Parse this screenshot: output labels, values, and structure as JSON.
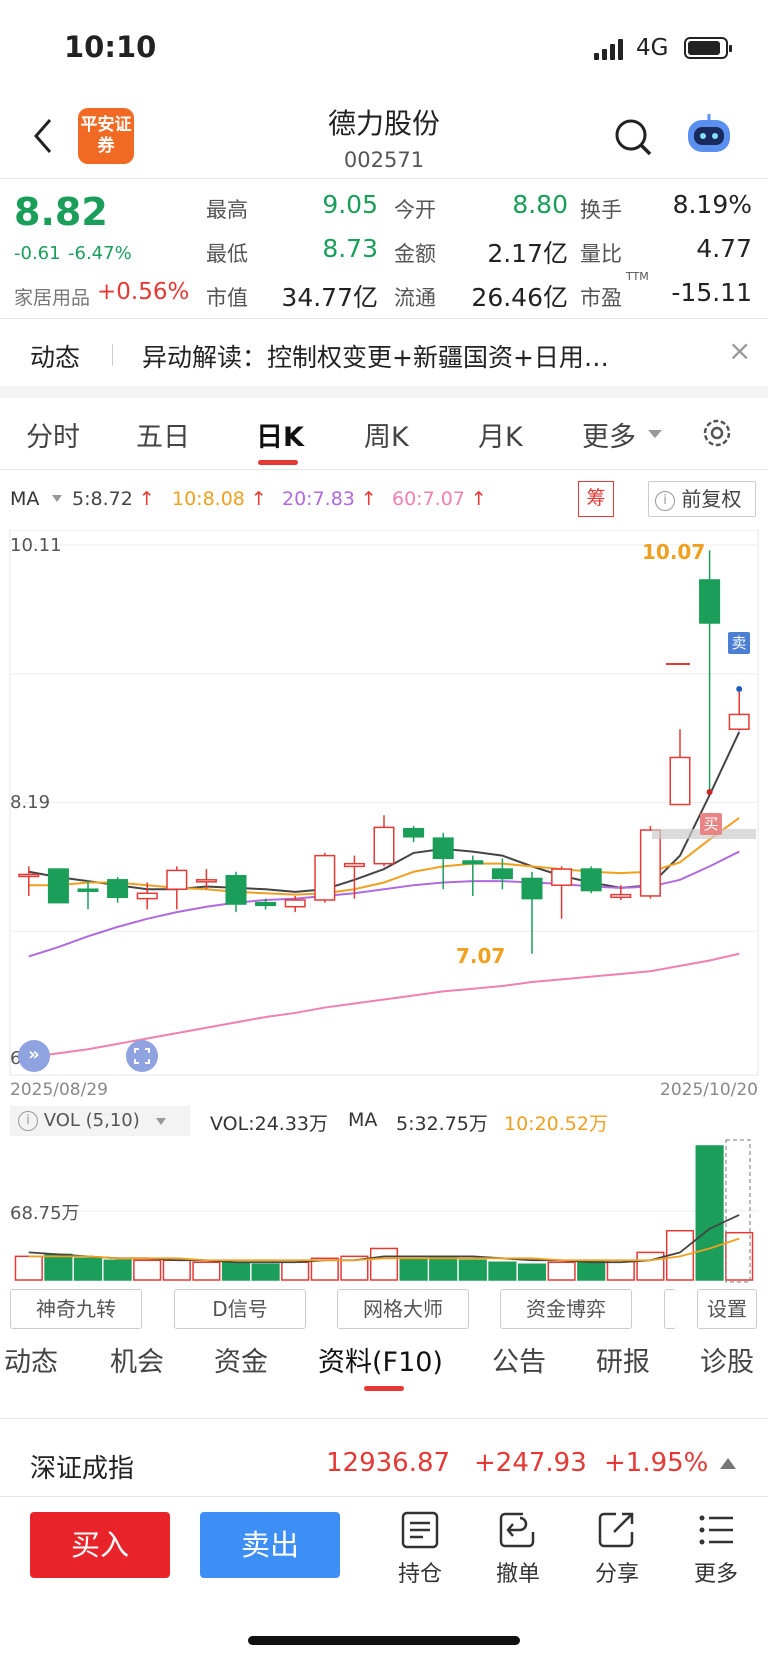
{
  "status": {
    "time": "10:10",
    "network": "4G",
    "battery_level": 0.9
  },
  "header": {
    "logo_text": "平安证券",
    "title": "德力股份",
    "code": "002571"
  },
  "quote": {
    "price": "8.82",
    "change": "-0.61",
    "change_pct": "-6.47%",
    "sector_name": "家居用品",
    "sector_change": "+0.56%",
    "fields": [
      {
        "label": "最高",
        "value": "9.05"
      },
      {
        "label": "今开",
        "value": "8.80"
      },
      {
        "label": "换手",
        "value": "8.19%"
      },
      {
        "label": "最低",
        "value": "8.73"
      },
      {
        "label": "金额",
        "value": "2.17亿"
      },
      {
        "label": "量比",
        "value": "4.77"
      },
      {
        "label": "市值",
        "value": "34.77亿"
      },
      {
        "label": "流通",
        "value": "26.46亿"
      },
      {
        "label": "市盈",
        "value": "-15.11"
      }
    ],
    "pe_superscript": "TTM"
  },
  "news": {
    "label": "动态",
    "text": "异动解读：控制权变更+新疆国资+日用…",
    "close": "×"
  },
  "kline_tabs": [
    "分时",
    "五日",
    "日K",
    "周K",
    "月K",
    "更多"
  ],
  "kline_active": 2,
  "ma_bar": {
    "label": "MA",
    "items": [
      {
        "text": "5:8.72",
        "color": "#444"
      },
      {
        "text": "10:8.08",
        "color": "#f0a020"
      },
      {
        "text": "20:7.83",
        "color": "#b06ae0"
      },
      {
        "text": "60:7.07",
        "color": "#f080b0"
      }
    ],
    "chip_label": "筹",
    "adjust_label": "前复权"
  },
  "chart": {
    "y_top": "10.11",
    "y_mid": "8.19",
    "y_bottom": "6.28",
    "high_label": "10.07",
    "low_label": "7.07",
    "sell_mark": "卖",
    "buy_mark": "买",
    "date_start": "2025/08/29",
    "date_end": "2025/10/20"
  },
  "chart_data": {
    "type": "candlestick",
    "x_start": "2025/08/29",
    "x_end": "2025/10/20",
    "ylim": [
      6.28,
      10.11
    ],
    "candles": [
      [
        7.65,
        7.66,
        7.72,
        7.5
      ],
      [
        7.7,
        7.45,
        7.7,
        7.45
      ],
      [
        7.55,
        7.54,
        7.62,
        7.4
      ],
      [
        7.62,
        7.49,
        7.64,
        7.45
      ],
      [
        7.48,
        7.52,
        7.6,
        7.4
      ],
      [
        7.55,
        7.69,
        7.72,
        7.4
      ],
      [
        7.61,
        7.62,
        7.7,
        7.55
      ],
      [
        7.65,
        7.44,
        7.68,
        7.38
      ],
      [
        7.45,
        7.43,
        7.48,
        7.4
      ],
      [
        7.42,
        7.47,
        7.5,
        7.38
      ],
      [
        7.47,
        7.8,
        7.82,
        7.45
      ],
      [
        7.72,
        7.74,
        7.8,
        7.48
      ],
      [
        7.74,
        8.01,
        8.1,
        7.72
      ],
      [
        8.0,
        7.94,
        8.02,
        7.9
      ],
      [
        7.93,
        7.78,
        7.97,
        7.55
      ],
      [
        7.76,
        7.74,
        7.8,
        7.5
      ],
      [
        7.7,
        7.63,
        7.78,
        7.55
      ],
      [
        7.63,
        7.48,
        7.68,
        7.07
      ],
      [
        7.58,
        7.7,
        7.72,
        7.33
      ],
      [
        7.7,
        7.54,
        7.72,
        7.52
      ],
      [
        7.49,
        7.51,
        7.58,
        7.47
      ],
      [
        7.5,
        7.99,
        8.02,
        7.48
      ],
      [
        8.18,
        8.53,
        8.74,
        8.18
      ],
      [
        9.85,
        9.53,
        10.07,
        8.27
      ],
      [
        8.74,
        8.85,
        9.05,
        8.73
      ]
    ],
    "ma": [
      {
        "name": "5",
        "color": "#444",
        "values": [
          7.68,
          7.64,
          7.61,
          7.58,
          7.55,
          7.55,
          7.57,
          7.56,
          7.55,
          7.53,
          7.55,
          7.62,
          7.7,
          7.82,
          7.85,
          7.83,
          7.8,
          7.72,
          7.65,
          7.6,
          7.56,
          7.58,
          7.8,
          8.25,
          8.72
        ]
      },
      {
        "name": "10",
        "color": "#f0a020",
        "values": [
          7.58,
          7.58,
          7.6,
          7.6,
          7.58,
          7.56,
          7.55,
          7.53,
          7.52,
          7.51,
          7.52,
          7.55,
          7.6,
          7.68,
          7.72,
          7.74,
          7.74,
          7.72,
          7.7,
          7.68,
          7.67,
          7.68,
          7.75,
          7.92,
          8.08
        ]
      },
      {
        "name": "20",
        "color": "#b06ae0",
        "values": [
          7.05,
          7.12,
          7.2,
          7.27,
          7.33,
          7.38,
          7.42,
          7.45,
          7.47,
          7.48,
          7.5,
          7.52,
          7.55,
          7.58,
          7.6,
          7.61,
          7.61,
          7.6,
          7.59,
          7.57,
          7.56,
          7.57,
          7.62,
          7.72,
          7.83
        ]
      },
      {
        "name": "60",
        "color": "#f080b0",
        "values": [
          6.3,
          6.33,
          6.36,
          6.4,
          6.44,
          6.48,
          6.52,
          6.56,
          6.6,
          6.63,
          6.67,
          6.7,
          6.73,
          6.76,
          6.79,
          6.81,
          6.83,
          6.86,
          6.88,
          6.9,
          6.92,
          6.94,
          6.98,
          7.02,
          7.07
        ]
      }
    ]
  },
  "volume": {
    "header": "VOL (5,10)",
    "vol_text": "VOL:24.33万",
    "ma_label": "MA",
    "ma5_text": "5:32.75万",
    "ma10_text": "10:20.52万",
    "scale_label": "68.75万",
    "bars": [
      12,
      13,
      11,
      10,
      10,
      10,
      9,
      9,
      8,
      9,
      11,
      12,
      16,
      11,
      12,
      10,
      9,
      8,
      9,
      10,
      10,
      14,
      25,
      68,
      24
    ],
    "ma5": [
      14,
      13,
      12,
      11,
      11,
      10,
      10,
      9,
      9,
      9,
      10,
      10,
      12,
      12,
      12,
      12,
      11,
      10,
      10,
      9,
      9,
      10,
      14,
      26,
      33
    ],
    "ma10": [
      12,
      12,
      12,
      11,
      11,
      11,
      10,
      10,
      10,
      10,
      10,
      10,
      11,
      11,
      11,
      11,
      11,
      11,
      10,
      10,
      10,
      10,
      12,
      16,
      21
    ]
  },
  "tools": [
    "神奇九转",
    "D信号",
    "网格大师",
    "资金博弈"
  ],
  "tools_setting": "设置",
  "bottom_tabs": [
    "动态",
    "机会",
    "资金",
    "资料(F10)",
    "公告",
    "研报",
    "诊股"
  ],
  "bottom_active": 3,
  "index": {
    "name": "深证成指",
    "value": "12936.87",
    "change": "+247.93",
    "pct": "+1.95%"
  },
  "actions": {
    "buy": "买入",
    "sell": "卖出",
    "hold": "持仓",
    "cancel": "撤单",
    "share": "分享",
    "more": "更多"
  }
}
